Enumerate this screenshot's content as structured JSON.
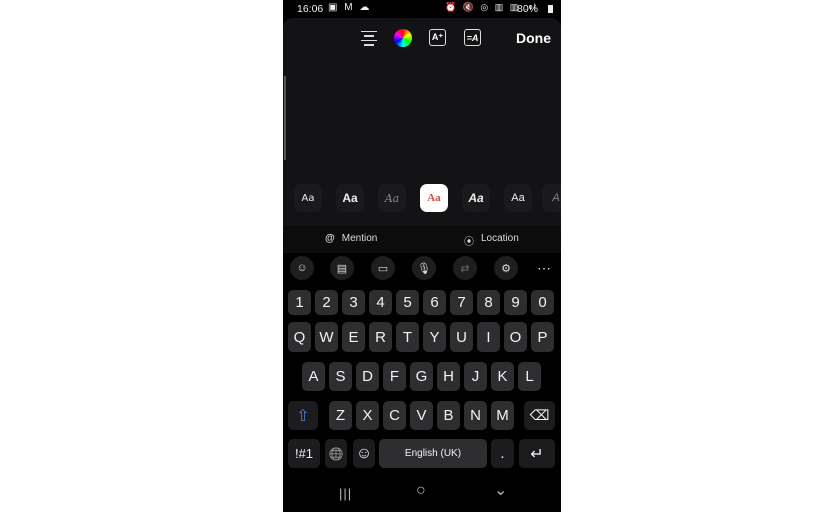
{
  "status": {
    "time": "16:06",
    "battery": "80%",
    "left_icons": [
      "gallery-icon",
      "gmail-icon",
      "cloud-icon"
    ],
    "right_icons": [
      "alarm-icon",
      "mute-icon",
      "hotspot-icon",
      "volte-icon",
      "4g-icon",
      "signal-icon",
      "battery-icon"
    ]
  },
  "toolbar": {
    "done_label": "Done",
    "icons": [
      "align-center-icon",
      "color-wheel-icon",
      "text-effect-icon",
      "text-background-icon"
    ]
  },
  "fonts": [
    {
      "label": "Aa",
      "style": "classic"
    },
    {
      "label": "Aa",
      "style": "bold"
    },
    {
      "label": "Aa",
      "style": "script"
    },
    {
      "label": "Aa",
      "style": "serif",
      "selected": true
    },
    {
      "label": "Aa",
      "style": "italic-bold"
    },
    {
      "label": "Aa",
      "style": "rounded"
    },
    {
      "label": "A",
      "style": "partial"
    }
  ],
  "suggestions": {
    "mention": "Mention",
    "location": "Location"
  },
  "keyboard_tools": [
    "emoji-icon",
    "sticker-icon",
    "clipboard-icon",
    "microphone-icon",
    "translate-icon",
    "settings-icon",
    "more-icon"
  ],
  "keys": {
    "numbers": [
      "1",
      "2",
      "3",
      "4",
      "5",
      "6",
      "7",
      "8",
      "9",
      "0"
    ],
    "row1": [
      "Q",
      "W",
      "E",
      "R",
      "T",
      "Y",
      "U",
      "I",
      "O",
      "P"
    ],
    "row2": [
      "A",
      "S",
      "D",
      "F",
      "G",
      "H",
      "J",
      "K",
      "L"
    ],
    "row3": [
      "Z",
      "X",
      "C",
      "V",
      "B",
      "N",
      "M"
    ],
    "symbols": "!#1",
    "space": "English (UK)",
    "period": ".",
    "shift": "⇧",
    "backspace": "⌫",
    "enter": "↵",
    "globe": "🌐",
    "emoji": "☺"
  },
  "nav": {
    "recents": "|||",
    "home": "○",
    "back": "⌄"
  },
  "colors": {
    "shift": "#4f7fd6",
    "selected_font_bg": "#ffffff",
    "selected_font_text": "#d0503f"
  }
}
